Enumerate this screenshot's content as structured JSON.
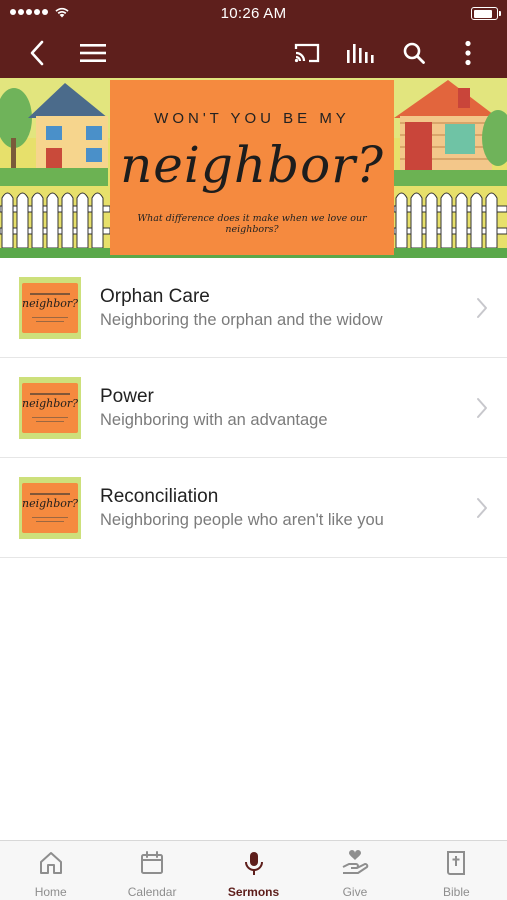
{
  "status_bar": {
    "time": "10:26 AM",
    "battery_level": 0.9
  },
  "nav": {
    "back_icon": "chevron-left-icon",
    "menu_icon": "hamburger-menu-icon",
    "cast_icon": "cast-icon",
    "library_icon": "audio-library-icon",
    "search_icon": "search-icon",
    "more_icon": "more-vertical-icon"
  },
  "banner": {
    "title": "WON'T YOU BE MY",
    "script": "neighbor?",
    "subtitle": "What difference does it make when we love our neighbors?"
  },
  "sermons": [
    {
      "title": "Orphan Care",
      "subtitle": "Neighboring the orphan and the widow"
    },
    {
      "title": "Power",
      "subtitle": "Neighboring with an advantage"
    },
    {
      "title": "Reconciliation",
      "subtitle": "Neighboring people who aren't like you"
    }
  ],
  "tabs": [
    {
      "label": "Home",
      "icon": "home-icon"
    },
    {
      "label": "Calendar",
      "icon": "calendar-icon"
    },
    {
      "label": "Sermons",
      "icon": "microphone-icon",
      "active": true
    },
    {
      "label": "Give",
      "icon": "give-hand-heart-icon"
    },
    {
      "label": "Bible",
      "icon": "bible-icon"
    }
  ],
  "colors": {
    "brand": "#5e1f1c",
    "banner_orange": "#f58a3f",
    "banner_green": "#cde07b"
  }
}
